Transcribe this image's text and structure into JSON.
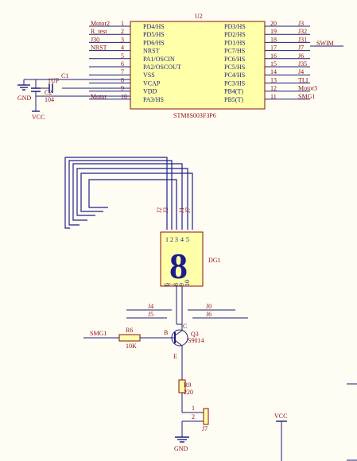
{
  "u2": {
    "ref": "U2",
    "part": "STM8S003F3P6",
    "left_pins": [
      {
        "num": "1",
        "name": "PD4/HS",
        "net": "Motor2"
      },
      {
        "num": "2",
        "name": "PD5/HS",
        "net": "R_test"
      },
      {
        "num": "3",
        "name": "PD6/HS",
        "net": "J30"
      },
      {
        "num": "4",
        "name": "NRST",
        "net": "NRST"
      },
      {
        "num": "5",
        "name": "PA1/OSCIN",
        "net": ""
      },
      {
        "num": "6",
        "name": "PA2/OSCOUT",
        "net": ""
      },
      {
        "num": "7",
        "name": "VSS",
        "net": ""
      },
      {
        "num": "8",
        "name": "VCAP",
        "net": ""
      },
      {
        "num": "9",
        "name": "VDD",
        "net": ""
      },
      {
        "num": "10",
        "name": "PA3/HS",
        "net": "Motor"
      }
    ],
    "right_pins": [
      {
        "num": "20",
        "name": "PD3/HS",
        "net": "J3"
      },
      {
        "num": "19",
        "name": "PD2/HS",
        "net": "J32"
      },
      {
        "num": "18",
        "name": "PD1/HS",
        "net": "J31"
      },
      {
        "num": "17",
        "name": "PC7/HS",
        "net": "J7"
      },
      {
        "num": "16",
        "name": "PC6/HS",
        "net": "J6"
      },
      {
        "num": "15",
        "name": "PC5/HS",
        "net": "J35"
      },
      {
        "num": "14",
        "name": "PC4/HS",
        "net": "J4"
      },
      {
        "num": "13",
        "name": "PC3/HS",
        "net": "TLI"
      },
      {
        "num": "12",
        "name": "PB4(T)",
        "net": "Motor3"
      },
      {
        "num": "11",
        "name": "PB5(T)",
        "net": "SMG1"
      }
    ],
    "swim_label": "SWIM"
  },
  "caps": {
    "c1_value": "1UF",
    "c1_ref": "C1",
    "c2_ref": "C2",
    "c2_value": "104",
    "gnd": "GND",
    "vcc": "VCC"
  },
  "dg1": {
    "ref": "DG1",
    "digit": "8",
    "top_pins": [
      "1",
      "2",
      "3",
      "4",
      "5"
    ],
    "bottom_pins": [
      "6",
      "7",
      "8",
      "9",
      "10"
    ],
    "top_nets": [
      "J2",
      "J3",
      "J1",
      "J7"
    ],
    "bottom_left_nets": [
      "J4",
      "J5"
    ],
    "bottom_right_nets": [
      "J0",
      "J6"
    ]
  },
  "q3": {
    "ref": "Q3",
    "part": "S9014",
    "b": "B",
    "c": "C",
    "e": "E"
  },
  "r6": {
    "ref": "R6",
    "value": "10K",
    "net": "SMG1"
  },
  "r9": {
    "ref": "R9",
    "value": "220"
  },
  "j7": {
    "ref": "J7",
    "pin1": "1",
    "pin2": "2",
    "gnd": "GND"
  },
  "vcc2": {
    "label": "VCC"
  }
}
